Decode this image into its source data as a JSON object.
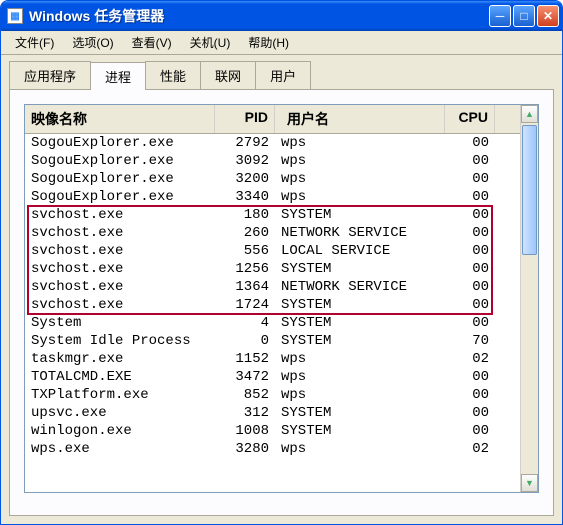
{
  "window": {
    "title": "Windows 任务管理器"
  },
  "menu": {
    "file": "文件(F)",
    "options": "选项(O)",
    "view": "查看(V)",
    "shutdown": "关机(U)",
    "help": "帮助(H)"
  },
  "tabs": {
    "apps": "应用程序",
    "processes": "进程",
    "performance": "性能",
    "networking": "联网",
    "users": "用户"
  },
  "columns": {
    "name": "映像名称",
    "pid": "PID",
    "user": "用户名",
    "cpu": "CPU"
  },
  "processes": [
    {
      "name": "SogouExplorer.exe",
      "pid": "2792",
      "user": "wps",
      "cpu": "00"
    },
    {
      "name": "SogouExplorer.exe",
      "pid": "3092",
      "user": "wps",
      "cpu": "00"
    },
    {
      "name": "SogouExplorer.exe",
      "pid": "3200",
      "user": "wps",
      "cpu": "00"
    },
    {
      "name": "SogouExplorer.exe",
      "pid": "3340",
      "user": "wps",
      "cpu": "00"
    },
    {
      "name": "svchost.exe",
      "pid": "180",
      "user": "SYSTEM",
      "cpu": "00"
    },
    {
      "name": "svchost.exe",
      "pid": "260",
      "user": "NETWORK SERVICE",
      "cpu": "00"
    },
    {
      "name": "svchost.exe",
      "pid": "556",
      "user": "LOCAL SERVICE",
      "cpu": "00"
    },
    {
      "name": "svchost.exe",
      "pid": "1256",
      "user": "SYSTEM",
      "cpu": "00"
    },
    {
      "name": "svchost.exe",
      "pid": "1364",
      "user": "NETWORK SERVICE",
      "cpu": "00"
    },
    {
      "name": "svchost.exe",
      "pid": "1724",
      "user": "SYSTEM",
      "cpu": "00"
    },
    {
      "name": "System",
      "pid": "4",
      "user": "SYSTEM",
      "cpu": "00"
    },
    {
      "name": "System Idle Process",
      "pid": "0",
      "user": "SYSTEM",
      "cpu": "70"
    },
    {
      "name": "taskmgr.exe",
      "pid": "1152",
      "user": "wps",
      "cpu": "02"
    },
    {
      "name": "TOTALCMD.EXE",
      "pid": "3472",
      "user": "wps",
      "cpu": "00"
    },
    {
      "name": "TXPlatform.exe",
      "pid": "852",
      "user": "wps",
      "cpu": "00"
    },
    {
      "name": "upsvc.exe",
      "pid": "312",
      "user": "SYSTEM",
      "cpu": "00"
    },
    {
      "name": "winlogon.exe",
      "pid": "1008",
      "user": "SYSTEM",
      "cpu": "00"
    },
    {
      "name": "wps.exe",
      "pid": "3280",
      "user": "wps",
      "cpu": "02"
    }
  ],
  "highlight": {
    "start": 4,
    "end": 9
  }
}
